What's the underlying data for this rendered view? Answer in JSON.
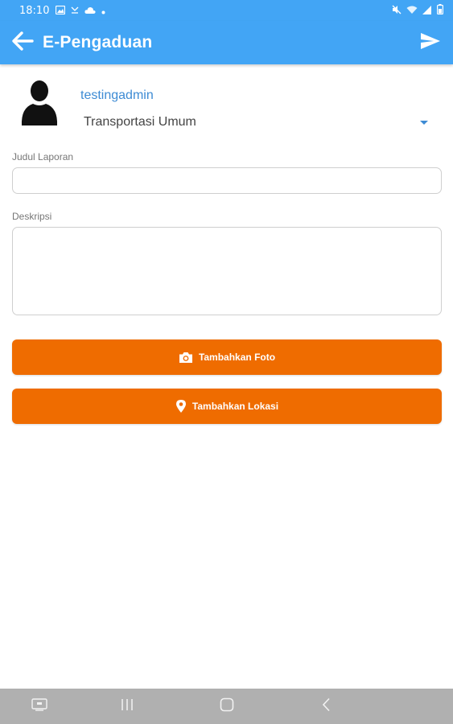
{
  "status_bar": {
    "time": "18:10",
    "left_icons": [
      "image-icon",
      "missed-call-icon",
      "cloud-icon",
      "dot-icon"
    ],
    "right_icons": [
      "mute-icon",
      "wifi-icon",
      "signal-icon",
      "battery-icon"
    ]
  },
  "app_bar": {
    "title": "E-Pengaduan",
    "back_icon": "arrow-left-icon",
    "send_icon": "send-icon",
    "color": "#42a5f5"
  },
  "user": {
    "name": "testingadmin",
    "avatar_icon": "person-icon"
  },
  "category": {
    "selected": "Transportasi Umum"
  },
  "form": {
    "title_label": "Judul Laporan",
    "title_value": "",
    "description_label": "Deskripsi",
    "description_value": ""
  },
  "buttons": {
    "add_photo": "Tambahkan Foto",
    "add_location": "Tambahkan Lokasi",
    "color": "#ef6c00"
  },
  "nav_bar": {
    "items": [
      "keyboard-icon",
      "recents-icon",
      "home-icon",
      "back-icon"
    ]
  }
}
